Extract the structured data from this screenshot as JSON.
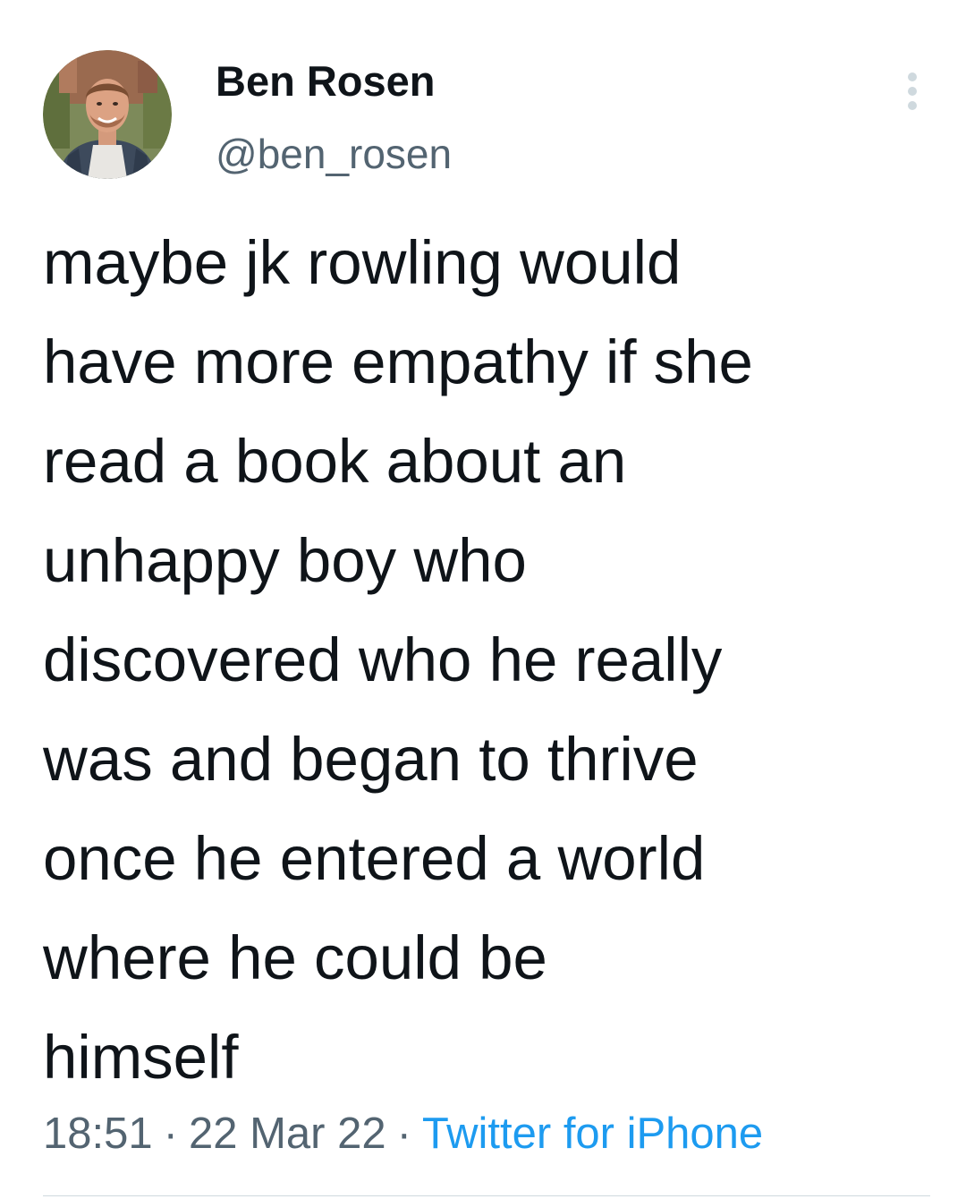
{
  "tweet": {
    "author": {
      "display_name": "Ben Rosen",
      "handle": "@ben_rosen",
      "avatar_icon": "profile-photo"
    },
    "more_icon": "vertical-ellipsis-icon",
    "text": "maybe jk rowling would\nhave more empathy if she\nread a book about an\nunhappy boy who\ndiscovered who he really\nwas and began to thrive\nonce he entered a world\nwhere he could be\nhimself",
    "meta": {
      "time": "18:51",
      "separator": "·",
      "date": "22 Mar 22",
      "source": "Twitter for iPhone"
    }
  },
  "colors": {
    "text_primary": "#0f1419",
    "text_secondary": "#536471",
    "link": "#1d9bf0",
    "divider": "#cfd9de"
  }
}
